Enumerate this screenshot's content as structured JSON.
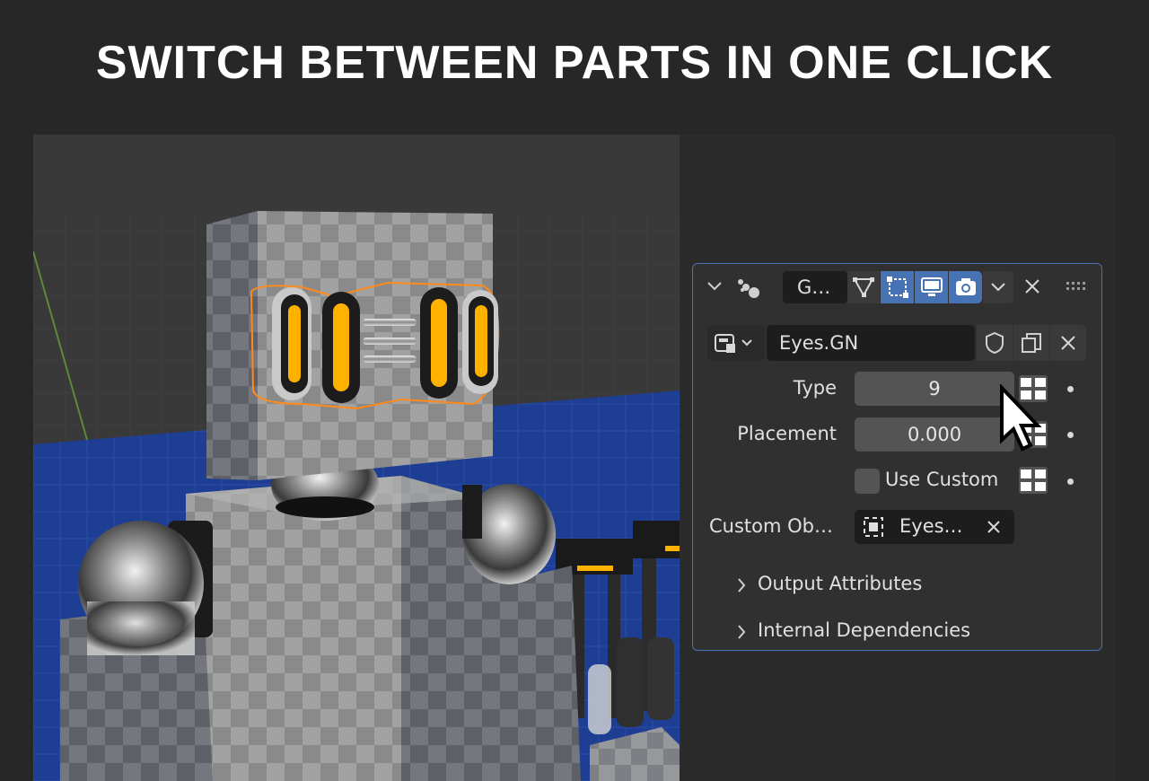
{
  "headline": "SWITCH BETWEEN PARTS IN ONE CLICK",
  "modifier": {
    "name_short": "G…",
    "node_group": "Eyes.GN",
    "inputs": {
      "type_label": "Type",
      "type_value": "9",
      "placement_label": "Placement",
      "placement_value": "0.000",
      "use_custom_label": "Use Custom",
      "use_custom_checked": false,
      "custom_object_label": "Custom Ob…",
      "custom_object_value": "Eyes…"
    },
    "panels": [
      {
        "label": "Output Attributes",
        "expanded": false
      },
      {
        "label": "Internal Dependencies",
        "expanded": false
      }
    ]
  },
  "colors": {
    "background": "#272727",
    "panel": "#303030",
    "accent": "#4772b3",
    "field": "#545454",
    "highlight_orange": "#ff8a1a",
    "emissive_yellow": "#ffb100",
    "floor_blue": "#1d3e93"
  },
  "icons": {
    "collapse": "chevron-down-icon",
    "modifier_type": "geometry-nodes-icon",
    "edit_mode": "edit-mode-icon",
    "cage": "cage-icon",
    "viewport": "monitor-icon",
    "render": "camera-icon",
    "options": "chevron-down-icon",
    "remove": "close-icon",
    "drag": "drag-handle-icon",
    "browse": "node-tree-browse-icon",
    "fake_user": "shield-icon",
    "duplicate": "duplicate-icon",
    "unlink": "close-icon",
    "attribute_toggle": "attribute-toggle-icon",
    "object": "object-icon",
    "cursor": "mouse-pointer-icon"
  }
}
